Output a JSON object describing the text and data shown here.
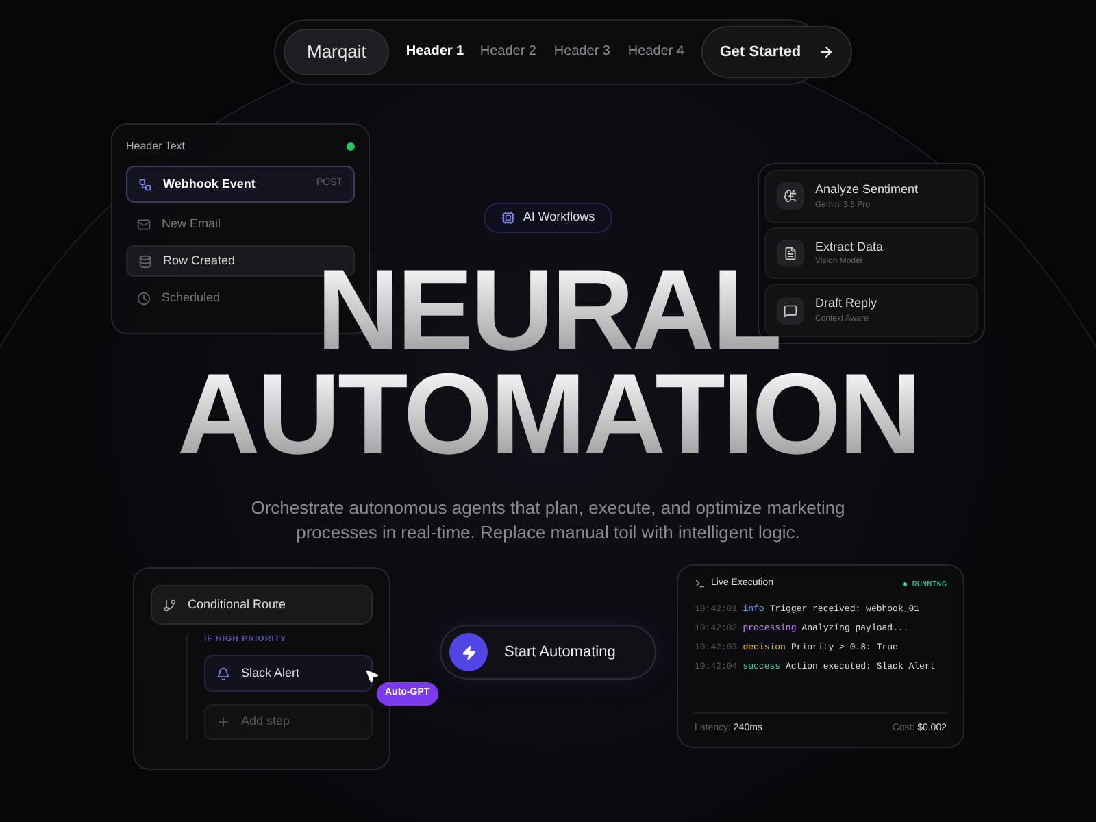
{
  "nav": {
    "brand": "Marqait",
    "links": [
      {
        "label": "Header 1",
        "selected": true
      },
      {
        "label": "Header 2",
        "selected": false
      },
      {
        "label": "Header 3",
        "selected": false
      },
      {
        "label": "Header 4",
        "selected": false
      }
    ],
    "cta": "Get Started"
  },
  "triggers": {
    "title": "Header Text",
    "items": [
      {
        "kind": "event",
        "label": "Webhook Event",
        "badge": "POST",
        "selected": false
      },
      {
        "kind": "item",
        "label": "New Email",
        "selected": false
      },
      {
        "kind": "item",
        "label": "Row Created",
        "selected": true
      },
      {
        "kind": "item",
        "label": "Scheduled",
        "selected": false
      }
    ]
  },
  "badge": "AI Workflows",
  "headline": [
    "NEURAL",
    "AUTOMATION"
  ],
  "subtitle": "Orchestrate autonomous agents that plan, execute, and optimize marketing processes in real-time. Replace manual toil with intelligent logic.",
  "models": [
    {
      "title": "Analyze Sentiment",
      "subtitle": "Gemini 3.5 Pro"
    },
    {
      "title": "Extract Data",
      "subtitle": "Vision Model"
    },
    {
      "title": "Draft Reply",
      "subtitle": "Context Aware"
    }
  ],
  "route": {
    "title": "Conditional Route",
    "condition": "IF HIGH PRIORITY",
    "action": "Slack Alert",
    "add": "Add step",
    "cursor_tag": "Auto-GPT"
  },
  "cta": "Start Automating",
  "log": {
    "title": "Live Execution",
    "status": "RUNNING",
    "entries": [
      {
        "time": "10:42:01",
        "kind": "info",
        "tag": "info",
        "message": "Trigger received: webhook_01"
      },
      {
        "time": "10:42:02",
        "kind": "processing",
        "tag": "processing",
        "message": "Analyzing payload..."
      },
      {
        "time": "10:42:03",
        "kind": "decision",
        "tag": "decision",
        "message": "Priority > 0.8: True"
      },
      {
        "time": "10:42:04",
        "kind": "success",
        "tag": "success",
        "message": "Action executed: Slack Alert"
      }
    ],
    "latency_label": "Latency:",
    "latency": "240ms",
    "cost_label": "Cost:",
    "cost": "$0.002"
  }
}
